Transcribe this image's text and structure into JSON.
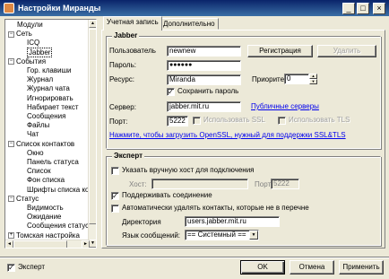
{
  "window": {
    "title": "Настройки Миранды"
  },
  "tree": {
    "items": [
      {
        "label": "Модули",
        "toggle": ""
      },
      {
        "label": "Сеть",
        "toggle": "−"
      },
      {
        "label": "ICQ",
        "toggle": ""
      },
      {
        "label": "Jabber",
        "toggle": ""
      },
      {
        "label": "События",
        "toggle": "−"
      },
      {
        "label": "Гор. клавиши",
        "toggle": ""
      },
      {
        "label": "Журнал",
        "toggle": ""
      },
      {
        "label": "Журнал чата",
        "toggle": ""
      },
      {
        "label": "Игнорировать",
        "toggle": ""
      },
      {
        "label": "Набирает текст",
        "toggle": ""
      },
      {
        "label": "Сообщения",
        "toggle": ""
      },
      {
        "label": "Файлы",
        "toggle": ""
      },
      {
        "label": "Чат",
        "toggle": ""
      },
      {
        "label": "Список контактов",
        "toggle": "−"
      },
      {
        "label": "Окно",
        "toggle": ""
      },
      {
        "label": "Панель статуса",
        "toggle": ""
      },
      {
        "label": "Список",
        "toggle": ""
      },
      {
        "label": "Фон списка",
        "toggle": ""
      },
      {
        "label": "Шрифты списка ко",
        "toggle": ""
      },
      {
        "label": "Статус",
        "toggle": "−"
      },
      {
        "label": "Видимость",
        "toggle": ""
      },
      {
        "label": "Ожидание",
        "toggle": ""
      },
      {
        "label": "Сообщения статус",
        "toggle": ""
      },
      {
        "label": "Томская настройка",
        "toggle": "+"
      }
    ]
  },
  "tabs": [
    {
      "label": "Учетная запись"
    },
    {
      "label": "Дополнительно"
    }
  ],
  "jabber": {
    "title": "Jabber",
    "user_label": "Пользователь",
    "user_value": "newnew",
    "register_button": "Регистрация",
    "delete_button": "Удалить",
    "password_label": "Пароль:",
    "password_value": "●●●●●●",
    "resource_label": "Ресурс:",
    "resource_value": "Miranda",
    "priority_label": "Приорите",
    "priority_value": "0",
    "save_password_label": "Сохранить пароль",
    "server_label": "Сервер:",
    "server_value": "jabber.mit.ru",
    "public_servers_link": "Публичные серверы",
    "port_label": "Порт:",
    "port_value": "5222",
    "use_ssl_label": "Использовать SSL",
    "use_tls_label": "Использовать TLS",
    "openssl_link": "Нажмите, чтобы загрузить OpenSSL, нужный для поддержки SSL&TLS"
  },
  "expert": {
    "title": "Эксперт",
    "manual_host_label": "Указать вручную хост для подключения",
    "host_label": "Хост:",
    "host_port_label": "Порт:",
    "host_port_value": "5222",
    "keepalive_label": "Поддерживать соединение",
    "auto_delete_label": "Автоматически удалять контакты, которые не в перечне",
    "directory_label": "Директория",
    "directory_value": "users.jabber.mit.ru",
    "lang_label": "Язык сообщений:",
    "lang_value": "== Системный =="
  },
  "footer": {
    "expert_label": "Эксперт",
    "ok": "OK",
    "cancel": "Отмена",
    "apply": "Применить"
  }
}
